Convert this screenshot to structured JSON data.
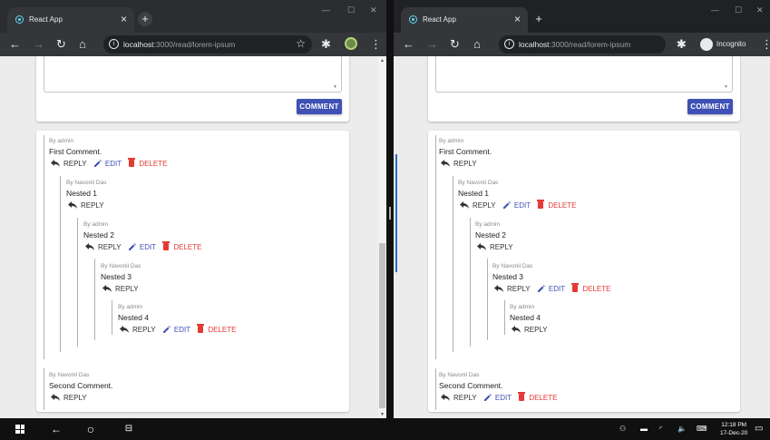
{
  "browser": {
    "tab_title": "React App",
    "tab_close": "×",
    "new_tab": "+",
    "url_host": "localhost",
    "url_path": ":3000/read/lorem-ipsum",
    "incognito_label": "Incognito",
    "window_controls": {
      "minimize": "—",
      "maximize": "☐",
      "close": "✕"
    }
  },
  "form": {
    "comment_button": "COMMENT"
  },
  "actions": {
    "reply": "REPLY",
    "edit": "EDIT",
    "delete": "DELETE"
  },
  "comments": [
    {
      "author": "By admin",
      "text": "First Comment."
    },
    {
      "author": "By Navonil Das",
      "text": "Nested 1"
    },
    {
      "author": "By admin",
      "text": "Nested 2"
    },
    {
      "author": "By Navonil Das",
      "text": "Nested 3"
    },
    {
      "author": "By admin",
      "text": "Nested 4"
    },
    {
      "author": "By Navonil Das",
      "text": "Second Comment."
    }
  ],
  "left_window": {
    "can_modify": [
      "admin"
    ],
    "user": "admin"
  },
  "right_window": {
    "can_modify": [
      "Navonil Das"
    ],
    "user": "Navonil Das"
  },
  "taskbar": {
    "time": "12:18 PM",
    "date": "17-Dec-20"
  },
  "colors": {
    "primary": "#3f51b5",
    "danger": "#e53935",
    "chrome_dark": "#202124"
  }
}
